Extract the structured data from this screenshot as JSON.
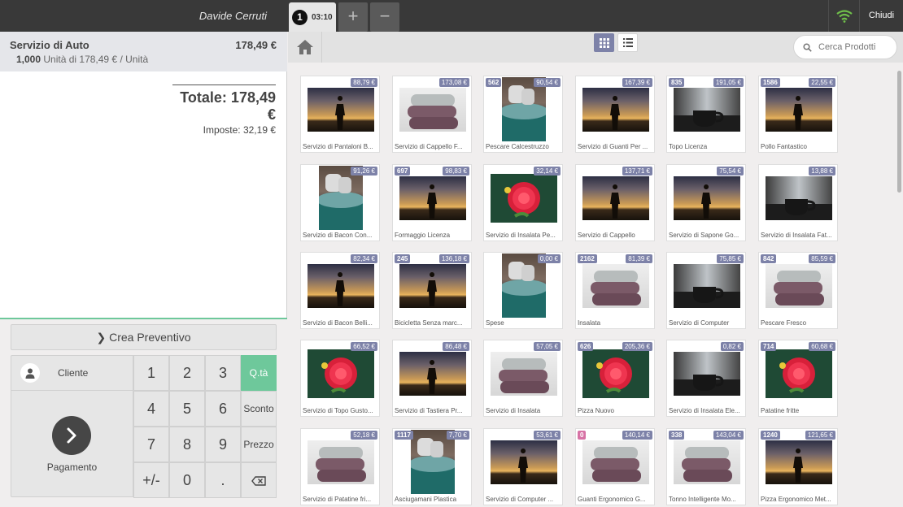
{
  "topbar": {
    "cashier": "Davide Cerruti",
    "order_number": "1",
    "order_time": "03:10",
    "add_label": "+",
    "remove_label": "−",
    "close_label": "Chiudi"
  },
  "order": {
    "line": {
      "name": "Servizio di Auto",
      "price": "178,49 €",
      "qty": "1,000",
      "unit_detail": "Unità di 178,49 € / Unità"
    },
    "total": "Totale: 178,49 €",
    "tax": "Imposte: 32,19 €"
  },
  "controls": {
    "quote": "Crea Preventivo",
    "customer": "Cliente",
    "payment": "Pagamento",
    "keys": [
      "1",
      "2",
      "3",
      "4",
      "5",
      "6",
      "7",
      "8",
      "9",
      "+/-",
      "0",
      "."
    ],
    "modes": [
      "Q.tà",
      "Sconto",
      "Prezzo"
    ]
  },
  "search": {
    "placeholder": "Cerca Prodotti"
  },
  "products": [
    {
      "name": "Servizio di Pantaloni B...",
      "price": "88,79 €",
      "stock": "",
      "img": "sunset"
    },
    {
      "name": "Servizio di Cappello F...",
      "price": "173,08 €",
      "stock": "",
      "img": "towel"
    },
    {
      "name": "Pescare Calcestruzzo",
      "price": "90,54 €",
      "stock": "562",
      "img": "glass"
    },
    {
      "name": "Servizio di Guanti Per ...",
      "price": "167,39 €",
      "stock": "",
      "img": "sunset"
    },
    {
      "name": "Topo Licenza",
      "price": "191,05 €",
      "stock": "835",
      "img": "cup"
    },
    {
      "name": "Pollo Fantastico",
      "price": "22,55 €",
      "stock": "1586",
      "img": "sunset"
    },
    {
      "name": "Servizio di Bacon Con...",
      "price": "91,26 €",
      "stock": "",
      "img": "glass"
    },
    {
      "name": "Formaggio Licenza",
      "price": "98,83 €",
      "stock": "697",
      "img": "sunset"
    },
    {
      "name": "Servizio di Insalata Pe...",
      "price": "32,14 €",
      "stock": "",
      "img": "flower"
    },
    {
      "name": "Servizio di Cappello",
      "price": "137,71 €",
      "stock": "",
      "img": "sunset"
    },
    {
      "name": "Servizio di Sapone Go...",
      "price": "75,54 €",
      "stock": "",
      "img": "sunset"
    },
    {
      "name": "Servizio di Insalata Fat...",
      "price": "13,88 €",
      "stock": "",
      "img": "cup"
    },
    {
      "name": "Servizio di Bacon Belli...",
      "price": "82,34 €",
      "stock": "",
      "img": "sunset"
    },
    {
      "name": "Bicicletta Senza marc...",
      "price": "136,18 €",
      "stock": "245",
      "img": "sunset"
    },
    {
      "name": "Spese",
      "price": "0,00 €",
      "stock": "",
      "img": "glass"
    },
    {
      "name": "Insalata",
      "price": "81,39 €",
      "stock": "2162",
      "img": "towel"
    },
    {
      "name": "Servizio di Computer",
      "price": "75,85 €",
      "stock": "",
      "img": "cup"
    },
    {
      "name": "Pescare Fresco",
      "price": "85,59 €",
      "stock": "842",
      "img": "towel"
    },
    {
      "name": "Servizio di Topo Gusto...",
      "price": "66,52 €",
      "stock": "",
      "img": "flower"
    },
    {
      "name": "Servizio di Tastiera Pr...",
      "price": "86,48 €",
      "stock": "",
      "img": "sunset"
    },
    {
      "name": "Servizio di Insalata",
      "price": "57,05 €",
      "stock": "",
      "img": "towel"
    },
    {
      "name": "Pizza Nuovo",
      "price": "205,36 €",
      "stock": "626",
      "img": "flower"
    },
    {
      "name": "Servizio di Insalata Ele...",
      "price": "0,82 €",
      "stock": "",
      "img": "cup"
    },
    {
      "name": "Patatine fritte",
      "price": "60,68 €",
      "stock": "714",
      "img": "flower"
    },
    {
      "name": "Servizio di Patatine fri...",
      "price": "52,18 €",
      "stock": "",
      "img": "towel"
    },
    {
      "name": "Asciugamani Plastica",
      "price": "7,70 €",
      "stock": "1117",
      "img": "glass"
    },
    {
      "name": "Servizio di Computer ...",
      "price": "53,61 €",
      "stock": "",
      "img": "sunset"
    },
    {
      "name": "Guanti Ergonomico G...",
      "price": "140,14 €",
      "stock": "0",
      "img": "towel"
    },
    {
      "name": "Tonno Intelligente Mo...",
      "price": "143,04 €",
      "stock": "338",
      "img": "towel"
    },
    {
      "name": "Pizza Ergonomico Met...",
      "price": "121,65 €",
      "stock": "1240",
      "img": "sunset"
    }
  ]
}
